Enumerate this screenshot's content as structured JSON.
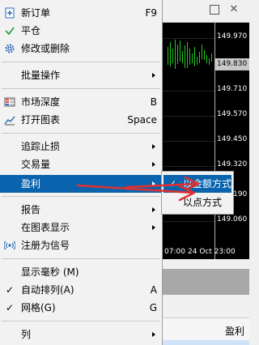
{
  "menu": {
    "items": [
      {
        "label": "新订单",
        "shortcut": "F9",
        "icon": "new-order-icon"
      },
      {
        "label": "平仓",
        "icon": "check-icon"
      },
      {
        "label": "修改或删除",
        "icon": "gear-icon"
      },
      {
        "label": "批量操作"
      },
      {
        "label": "市场深度",
        "shortcut": "B",
        "icon": "market-depth-icon"
      },
      {
        "label": "打开图表",
        "shortcut": "Space",
        "icon": "chart-line-icon"
      },
      {
        "label": "追踪止损"
      },
      {
        "label": "交易量"
      },
      {
        "label": "盈利"
      },
      {
        "label": "报告"
      },
      {
        "label": "在图表显示"
      },
      {
        "label": "注册为信号",
        "icon": "signal-icon"
      },
      {
        "label": "显示毫秒 (M)"
      },
      {
        "label": "自动排列(A)",
        "shortcut": "A",
        "checked": true
      },
      {
        "label": "网格(G)",
        "shortcut": "G",
        "checked": true
      },
      {
        "label": "列"
      }
    ]
  },
  "submenu": {
    "items": [
      {
        "label": "以金额方式",
        "checked": true
      },
      {
        "label": "以点方式"
      }
    ]
  },
  "chart": {
    "prices": [
      "149.970",
      "149.830",
      "149.710",
      "149.570",
      "149.450",
      "149.320",
      "149.190",
      "149.060"
    ],
    "time_labels": [
      "07:00",
      "24 Oct 23:00"
    ]
  },
  "table_header": {
    "column": "盈利"
  },
  "colors": {
    "selection": "#0a64ad",
    "arrow": "#e03030",
    "bars": "#22cc22"
  }
}
